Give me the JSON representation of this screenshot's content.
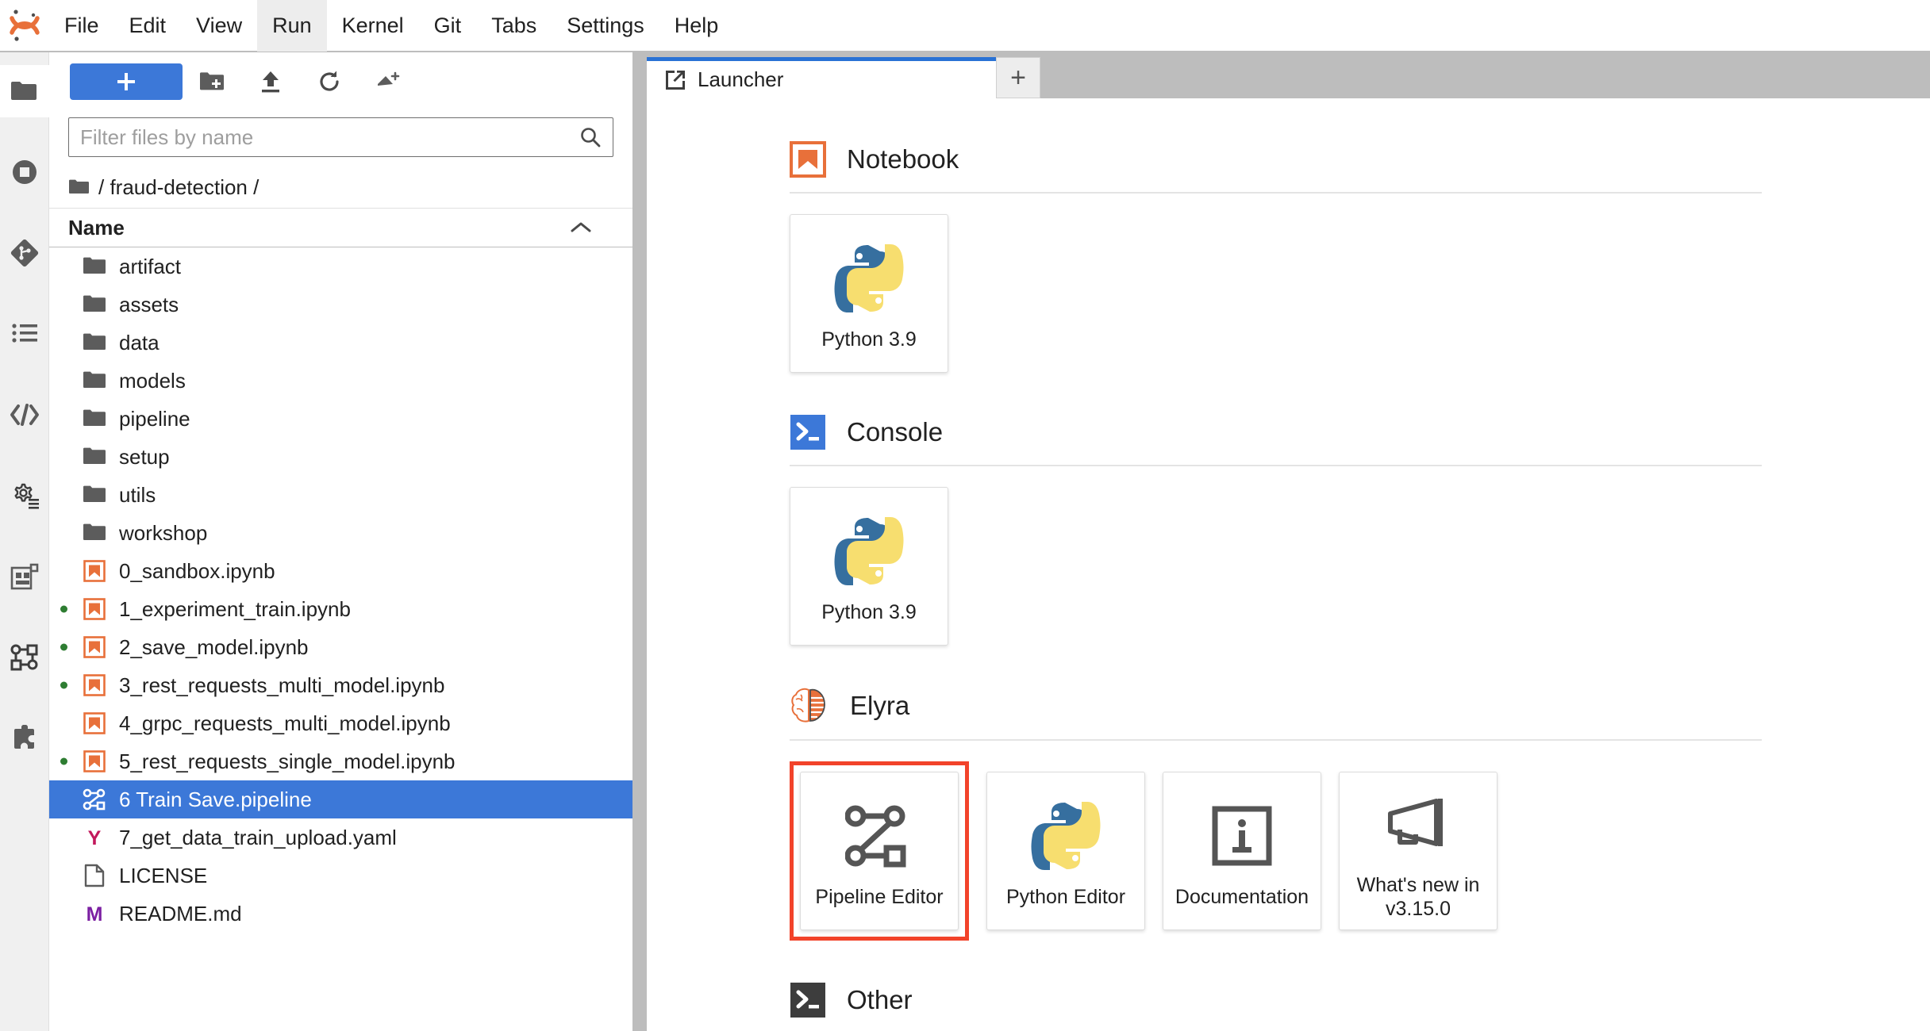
{
  "app": {
    "logo_name": "jupyter-logo",
    "menu": [
      {
        "label": "File",
        "active": false
      },
      {
        "label": "Edit",
        "active": false
      },
      {
        "label": "View",
        "active": false
      },
      {
        "label": "Run",
        "active": true
      },
      {
        "label": "Kernel",
        "active": false
      },
      {
        "label": "Git",
        "active": false
      },
      {
        "label": "Tabs",
        "active": false
      },
      {
        "label": "Settings",
        "active": false
      },
      {
        "label": "Help",
        "active": false
      }
    ]
  },
  "activitybar": {
    "items": [
      {
        "icon": "folder-icon",
        "name": "file-browser",
        "selected": true
      },
      {
        "icon": "running-terminals-icon",
        "name": "running-sessions",
        "selected": false
      },
      {
        "icon": "git-icon",
        "name": "git-panel",
        "selected": false
      },
      {
        "icon": "table-of-contents-icon",
        "name": "table-of-contents",
        "selected": false
      },
      {
        "icon": "code-icon",
        "name": "code-snippets",
        "selected": false
      },
      {
        "icon": "gear-list-icon",
        "name": "runtimes",
        "selected": false
      },
      {
        "icon": "components-icon",
        "name": "component-catalogs",
        "selected": false
      },
      {
        "icon": "pipeline-nodes-icon",
        "name": "pipeline-nodes",
        "selected": false
      },
      {
        "icon": "puzzle-icon",
        "name": "extension-manager",
        "selected": false
      }
    ]
  },
  "filebrowser": {
    "toolbar": {
      "new_launcher_label": "+",
      "new_folder_icon": "new-folder-icon",
      "upload_icon": "upload-icon",
      "refresh_icon": "refresh-icon",
      "new_pipeline_icon": "new-pipeline-icon"
    },
    "filter": {
      "placeholder": "Filter files by name",
      "value": "",
      "icon": "search-icon"
    },
    "breadcrumb": {
      "home_icon": "folder-icon",
      "path": "/ fraud-detection /"
    },
    "column_header": {
      "name": "Name",
      "sort_icon": "chevron-up-icon"
    },
    "items": [
      {
        "label": "artifact",
        "type": "folder",
        "running": false,
        "selected": false
      },
      {
        "label": "assets",
        "type": "folder",
        "running": false,
        "selected": false
      },
      {
        "label": "data",
        "type": "folder",
        "running": false,
        "selected": false
      },
      {
        "label": "models",
        "type": "folder",
        "running": false,
        "selected": false
      },
      {
        "label": "pipeline",
        "type": "folder",
        "running": false,
        "selected": false
      },
      {
        "label": "setup",
        "type": "folder",
        "running": false,
        "selected": false
      },
      {
        "label": "utils",
        "type": "folder",
        "running": false,
        "selected": false
      },
      {
        "label": "workshop",
        "type": "folder",
        "running": false,
        "selected": false
      },
      {
        "label": "0_sandbox.ipynb",
        "type": "notebook",
        "running": false,
        "selected": false
      },
      {
        "label": "1_experiment_train.ipynb",
        "type": "notebook",
        "running": true,
        "selected": false
      },
      {
        "label": "2_save_model.ipynb",
        "type": "notebook",
        "running": true,
        "selected": false
      },
      {
        "label": "3_rest_requests_multi_model.ipynb",
        "type": "notebook",
        "running": true,
        "selected": false
      },
      {
        "label": "4_grpc_requests_multi_model.ipynb",
        "type": "notebook",
        "running": false,
        "selected": false
      },
      {
        "label": "5_rest_requests_single_model.ipynb",
        "type": "notebook",
        "running": true,
        "selected": false
      },
      {
        "label": "6 Train Save.pipeline",
        "type": "pipeline",
        "running": false,
        "selected": true
      },
      {
        "label": "7_get_data_train_upload.yaml",
        "type": "yaml",
        "running": false,
        "selected": false
      },
      {
        "label": "LICENSE",
        "type": "file",
        "running": false,
        "selected": false
      },
      {
        "label": "README.md",
        "type": "markdown",
        "running": false,
        "selected": false
      }
    ]
  },
  "mainarea": {
    "tabs": [
      {
        "label": "Launcher",
        "icon": "launcher-icon",
        "active": true
      }
    ],
    "add_tab_label": "+"
  },
  "launcher": {
    "sections": [
      {
        "title": "Notebook",
        "icon": "notebook-icon",
        "cards": [
          {
            "label": "Python 3.9",
            "icon": "python-logo",
            "highlight": false
          }
        ]
      },
      {
        "title": "Console",
        "icon": "console-icon",
        "cards": [
          {
            "label": "Python 3.9",
            "icon": "python-logo",
            "highlight": false
          }
        ]
      },
      {
        "title": "Elyra",
        "icon": "elyra-icon",
        "cards": [
          {
            "label": "Pipeline Editor",
            "icon": "pipeline-editor-icon",
            "highlight": true
          },
          {
            "label": "Python Editor",
            "icon": "python-logo",
            "highlight": false
          },
          {
            "label": "Documentation",
            "icon": "info-icon",
            "highlight": false
          },
          {
            "label": "What's new in v3.15.0",
            "icon": "megaphone-icon",
            "highlight": false
          }
        ]
      },
      {
        "title": "Other",
        "icon": "terminal-icon",
        "cards": []
      }
    ]
  },
  "colors": {
    "accent_blue": "#3c78d8",
    "tab_active_blue": "#2972d5",
    "highlight_red": "#f2432a",
    "notebook_orange": "#e8703a",
    "running_green": "#2e7d32",
    "yaml_magenta": "#c2185b",
    "markdown_purple": "#7b1fa2",
    "folder_gray": "#5c5c5c"
  }
}
